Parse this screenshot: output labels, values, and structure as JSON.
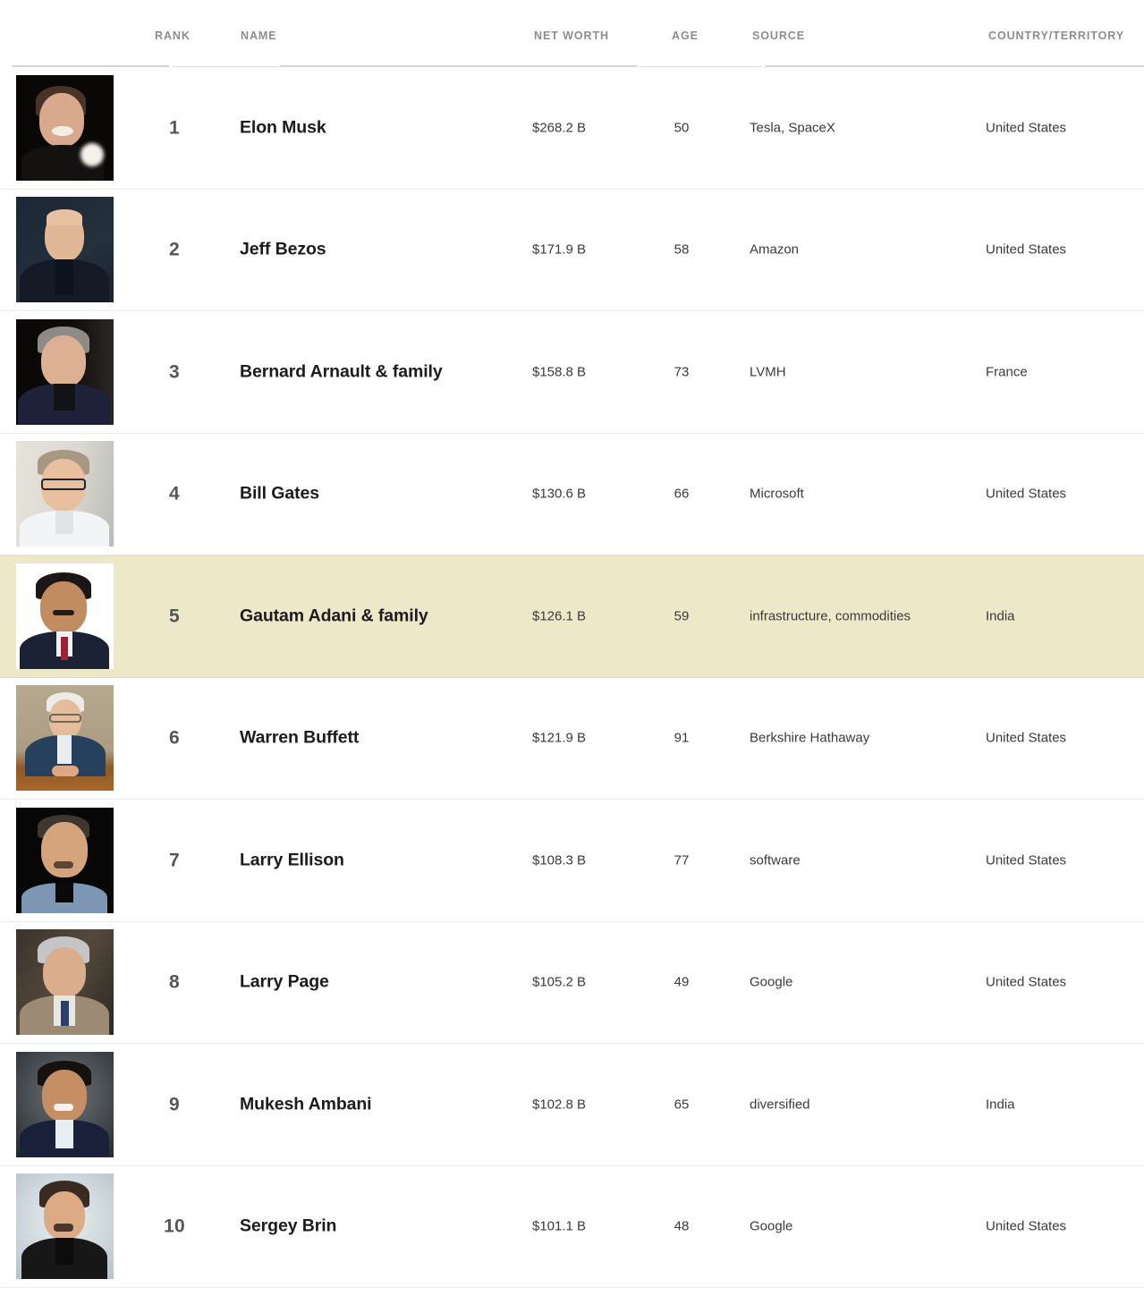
{
  "table": {
    "columns": [
      {
        "key": "rank",
        "label": "RANK"
      },
      {
        "key": "name",
        "label": "NAME"
      },
      {
        "key": "worth",
        "label": "NET WORTH"
      },
      {
        "key": "age",
        "label": "AGE"
      },
      {
        "key": "source",
        "label": "SOURCE"
      },
      {
        "key": "country",
        "label": "COUNTRY/TERRITORY"
      }
    ],
    "highlight_color": "#ede9c8",
    "highlighted_rank": "5",
    "rows": [
      {
        "rank": "1",
        "name": "Elon Musk",
        "worth": "$268.2 B",
        "age": "50",
        "source": "Tesla, SpaceX",
        "country": "United States",
        "photo": "portrait-elon-musk"
      },
      {
        "rank": "2",
        "name": "Jeff Bezos",
        "worth": "$171.9 B",
        "age": "58",
        "source": "Amazon",
        "country": "United States",
        "photo": "portrait-jeff-bezos"
      },
      {
        "rank": "3",
        "name": "Bernard Arnault & family",
        "worth": "$158.8 B",
        "age": "73",
        "source": "LVMH",
        "country": "France",
        "photo": "portrait-bernard-arnault"
      },
      {
        "rank": "4",
        "name": "Bill Gates",
        "worth": "$130.6 B",
        "age": "66",
        "source": "Microsoft",
        "country": "United States",
        "photo": "portrait-bill-gates"
      },
      {
        "rank": "5",
        "name": "Gautam Adani & family",
        "worth": "$126.1 B",
        "age": "59",
        "source": "infrastructure, commodities",
        "country": "India",
        "photo": "portrait-gautam-adani"
      },
      {
        "rank": "6",
        "name": "Warren Buffett",
        "worth": "$121.9 B",
        "age": "91",
        "source": "Berkshire Hathaway",
        "country": "United States",
        "photo": "portrait-warren-buffett"
      },
      {
        "rank": "7",
        "name": "Larry Ellison",
        "worth": "$108.3 B",
        "age": "77",
        "source": "software",
        "country": "United States",
        "photo": "portrait-larry-ellison"
      },
      {
        "rank": "8",
        "name": "Larry Page",
        "worth": "$105.2 B",
        "age": "49",
        "source": "Google",
        "country": "United States",
        "photo": "portrait-larry-page"
      },
      {
        "rank": "9",
        "name": "Mukesh Ambani",
        "worth": "$102.8 B",
        "age": "65",
        "source": "diversified",
        "country": "India",
        "photo": "portrait-mukesh-ambani"
      },
      {
        "rank": "10",
        "name": "Sergey Brin",
        "worth": "$101.1 B",
        "age": "48",
        "source": "Google",
        "country": "United States",
        "photo": "portrait-sergey-brin"
      }
    ]
  }
}
